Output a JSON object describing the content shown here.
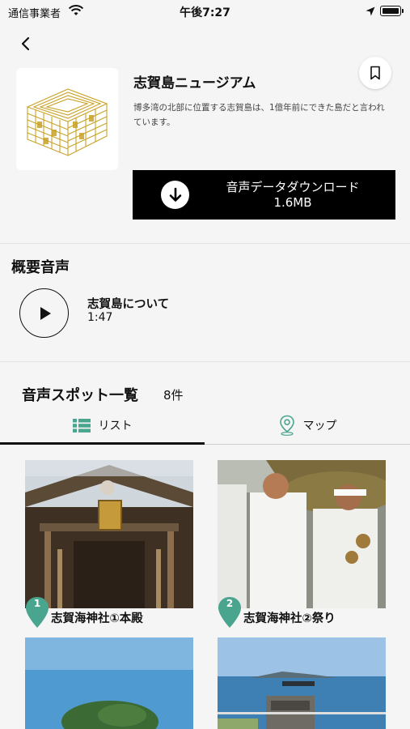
{
  "status_bar": {
    "carrier": "通信事業者",
    "time": "午後7:27"
  },
  "museum": {
    "title": "志賀島ニュージアム",
    "description": "博多湾の北部に位置する志賀島は、1億年前にできた島だと言われています。"
  },
  "download": {
    "label": "音声データダウンロード",
    "size": "1.6MB"
  },
  "overview": {
    "heading": "概要音声",
    "audio_title": "志賀島について",
    "duration": "1:47"
  },
  "spots": {
    "heading": "音声スポット一覧",
    "count": "8件",
    "tabs": [
      {
        "label": "リスト",
        "active": true
      },
      {
        "label": "マップ",
        "active": false
      }
    ],
    "items": [
      {
        "number": "1",
        "name": "志賀海神社①本殿"
      },
      {
        "number": "2",
        "name": "志賀海神社②祭り"
      }
    ]
  },
  "colors": {
    "accent": "#4aa58f",
    "seal_gold": "#c9a227",
    "download_bg": "#000000"
  }
}
